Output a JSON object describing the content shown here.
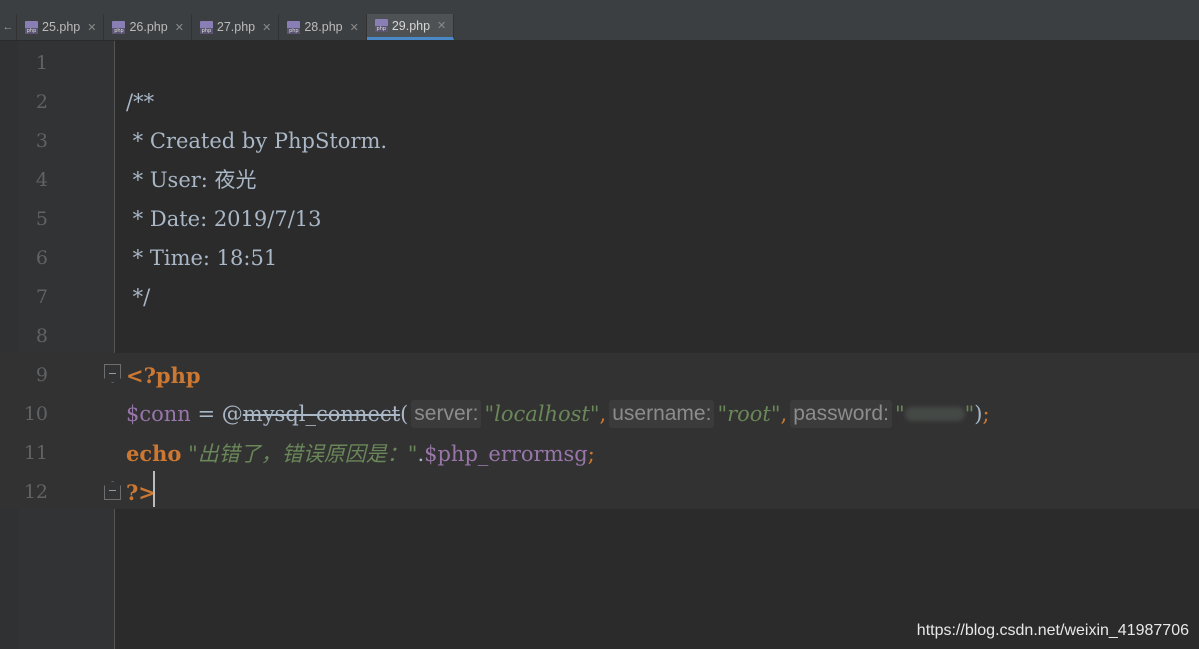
{
  "tabs": [
    {
      "label": "25.php",
      "active": false
    },
    {
      "label": "26.php",
      "active": false
    },
    {
      "label": "27.php",
      "active": false
    },
    {
      "label": "28.php",
      "active": false
    },
    {
      "label": "29.php",
      "active": true
    }
  ],
  "line_numbers": [
    "1",
    "2",
    "3",
    "4",
    "5",
    "6",
    "7",
    "8",
    "9",
    "10",
    "11",
    "12"
  ],
  "code": {
    "l2": "/**",
    "l3": " * Created by PhpStorm.",
    "l4": " * User: 夜光",
    "l5": " * Date: 2019/7/13",
    "l6": " * Time: 18:51",
    "l7": " */",
    "l9_open": "<?php",
    "l10_var": "$conn",
    "l10_eq": " = ",
    "l10_at": "@",
    "l10_fn": "mysql_connect",
    "l10_paren": "(",
    "l10_hint_server": "server:",
    "l10_str_server": "\"localhost\"",
    "l10_comma1": ",",
    "l10_hint_user": "username:",
    "l10_str_user": "\"root\"",
    "l10_comma2": ",",
    "l10_hint_pass": "password:",
    "l10_quote_open": "\"",
    "l10_quote_close": "\"",
    "l10_close": ")",
    "l10_semi": ";",
    "l11_echo": "echo",
    "l11_str": " \"出错了，错误原因是：\"",
    "l11_dot": ".",
    "l11_var": "$php_errormsg",
    "l11_semi": ";",
    "l12_close": "?>"
  },
  "watermark": "https://blog.csdn.net/weixin_41987706",
  "colors": {
    "keyword": "#cc7832",
    "variable": "#9876aa",
    "string": "#6a8759",
    "text": "#a9b7c6",
    "background": "#2b2b2b"
  }
}
